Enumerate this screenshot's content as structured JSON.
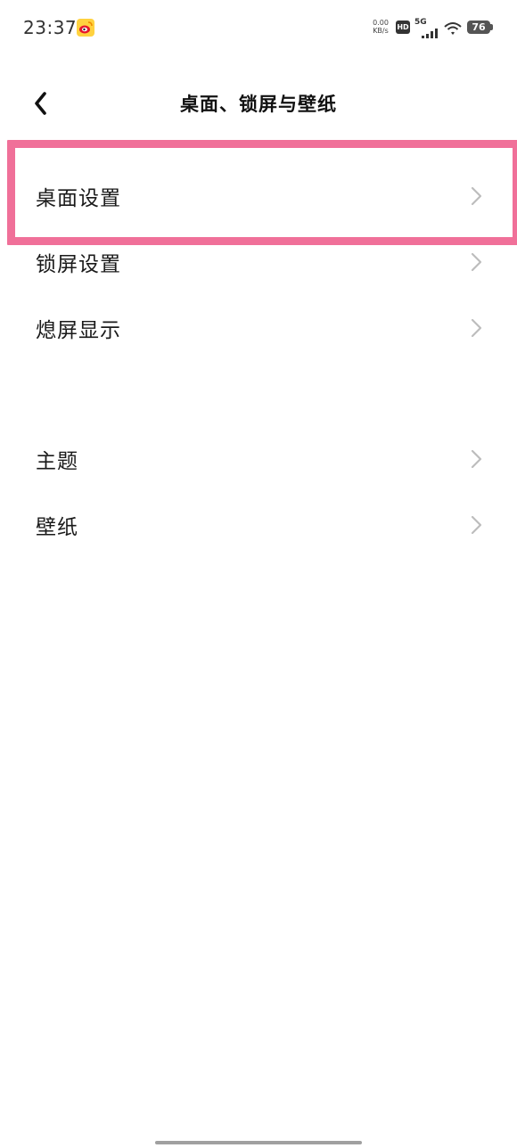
{
  "status_bar": {
    "time": "23:37",
    "net_speed_value": "0.00",
    "net_speed_unit": "KB/s",
    "hd_badge": "HD",
    "network_type": "5G",
    "battery_level": "76"
  },
  "header": {
    "back_icon": "chevron-left-icon",
    "title": "桌面、锁屏与壁纸"
  },
  "groups": [
    {
      "items": [
        {
          "label": "桌面设置",
          "icon": "chevron-right-icon"
        },
        {
          "label": "锁屏设置",
          "icon": "chevron-right-icon"
        },
        {
          "label": "熄屏显示",
          "icon": "chevron-right-icon"
        }
      ]
    },
    {
      "items": [
        {
          "label": "主题",
          "icon": "chevron-right-icon"
        },
        {
          "label": "壁纸",
          "icon": "chevron-right-icon"
        }
      ]
    }
  ],
  "colors": {
    "highlight_border": "#f07099",
    "chevron": "#bdbdbd"
  }
}
